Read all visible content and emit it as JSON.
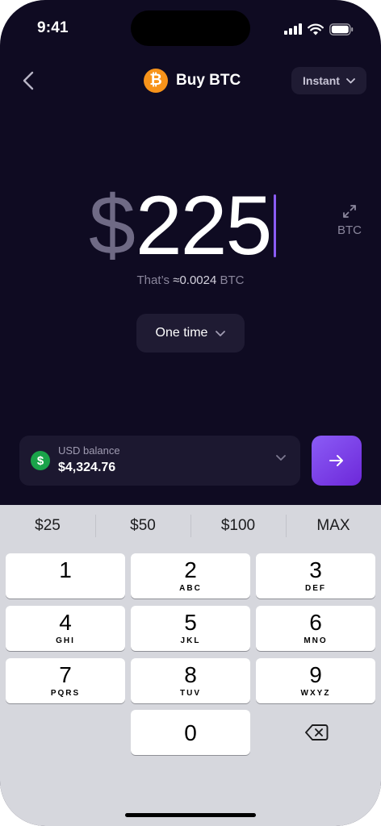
{
  "status_bar": {
    "time": "9:41"
  },
  "header": {
    "back_icon": "chevron-left-icon",
    "logo_glyph": "₿",
    "title": "Buy BTC",
    "speed_select": "Instant"
  },
  "amount": {
    "currency_symbol": "$",
    "value": "225",
    "toggle_label": "BTC"
  },
  "equivalent": {
    "prefix": "That’s",
    "value": "≈0.0024",
    "unit": "BTC"
  },
  "frequency_select": "One time",
  "balance": {
    "icon_glyph": "$",
    "label": "USD balance",
    "value": "$4,324.76"
  },
  "keyboard": {
    "quick_amounts": [
      "$25",
      "$50",
      "$100",
      "MAX"
    ],
    "keys": [
      {
        "digit": "1",
        "letters": ""
      },
      {
        "digit": "2",
        "letters": "ABC"
      },
      {
        "digit": "3",
        "letters": "DEF"
      },
      {
        "digit": "4",
        "letters": "GHI"
      },
      {
        "digit": "5",
        "letters": "JKL"
      },
      {
        "digit": "6",
        "letters": "MNO"
      },
      {
        "digit": "7",
        "letters": "PQRS"
      },
      {
        "digit": "8",
        "letters": "TUV"
      },
      {
        "digit": "9",
        "letters": "WXYZ"
      },
      {
        "digit": "0",
        "letters": ""
      }
    ],
    "delete_icon": "backspace-icon"
  },
  "colors": {
    "background": "#0f0b22",
    "accent": "#8b5cf6",
    "btc_orange": "#f7931a",
    "usd_green": "#1aa34a",
    "keyboard_bg": "#d6d7dd"
  }
}
